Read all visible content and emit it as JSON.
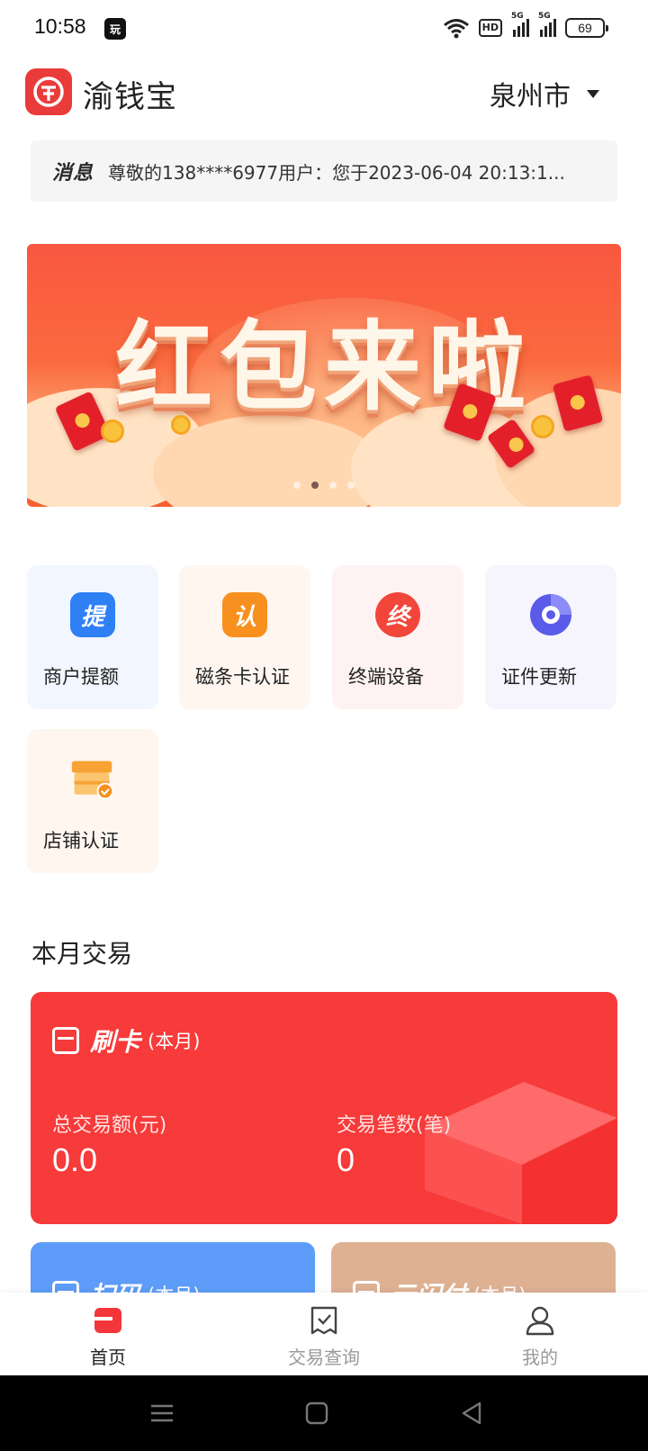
{
  "status_bar": {
    "time": "10:58",
    "app_badge": "玩",
    "battery": "69",
    "hd": "HD",
    "net1": "5G",
    "net2": "5G"
  },
  "header": {
    "app_name": "渝钱宝",
    "city": "泉州市"
  },
  "notice": {
    "tag": "消息",
    "text": "尊敬的138****6977用户：您于2023-06-04 20:13:1..."
  },
  "banner": {
    "title": "红包来啦",
    "page_count": 4,
    "active_page": 2
  },
  "features": [
    {
      "label": "商户提额",
      "icon": "ti-icon",
      "glyph": "提",
      "color": "#2f7ff5"
    },
    {
      "label": "磁条卡认证",
      "icon": "ren-icon",
      "glyph": "认",
      "color": "#f7901e"
    },
    {
      "label": "终端设备",
      "icon": "zhong-icon",
      "glyph": "终",
      "color": "#f2463a"
    },
    {
      "label": "证件更新",
      "icon": "refresh-icon",
      "glyph": "",
      "color": "#5a5be8"
    },
    {
      "label": "店铺认证",
      "icon": "shop-icon",
      "glyph": "",
      "color": "#f7a234"
    }
  ],
  "month": {
    "title": "本月交易",
    "card_swipe": {
      "title": "刷卡",
      "period": "(本月)",
      "amount_label": "总交易额(元)",
      "amount_value": "0.0",
      "count_label": "交易笔数(笔)",
      "count_value": "0"
    },
    "card_scan": {
      "title": "扫码",
      "period": "(本月)"
    },
    "card_cloud": {
      "title": "云闪付",
      "period": "(本月)"
    }
  },
  "bottom_nav": [
    {
      "label": "首页",
      "active": true
    },
    {
      "label": "交易查询",
      "active": false
    },
    {
      "label": "我的",
      "active": false
    }
  ],
  "colors": {
    "brand_red": "#f73a3a",
    "scan_blue": "#5d9cf8",
    "cloud_tan": "#deb193"
  }
}
